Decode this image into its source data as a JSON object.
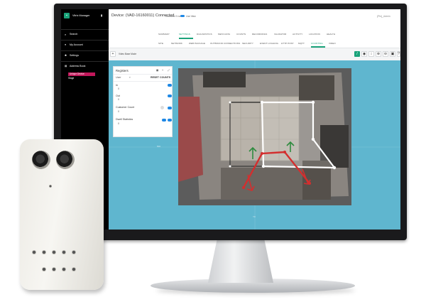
{
  "app": {
    "title": "Vitrix Manager",
    "brand_color": "#1aa37a",
    "accent_color": "#1e88e5",
    "highlight_color": "#c2185b"
  },
  "sidebar": {
    "search": "Search",
    "items": [
      "My Account",
      "Settings",
      "Address Book"
    ],
    "sub_items": [
      "Unique Device",
      "Stage"
    ]
  },
  "header": {
    "device_title": "Device: (VAD-16160011) Connected",
    "status_label": "Database Error",
    "live_view": "Live View",
    "user": "{Pin}_Admin"
  },
  "tabs_primary": [
    "SUMMARY",
    "SETTINGS",
    "DIAGNOSTICS",
    "META DATA",
    "COUNTS",
    "RECORDINGS",
    "VALIDATOR",
    "ACTIVITY",
    "LOCATION",
    "HEALTH"
  ],
  "tabs_primary_active": "SETTINGS",
  "tabs_secondary": [
    "SITE",
    "NETWORK",
    "WEB PACKAGE",
    "OUTBOUND CONNECTIONS",
    "SECURITY",
    "EVENT LOGGING",
    "HTTP POST",
    "MQTT",
    "COUNTING",
    "VIDEO"
  ],
  "tabs_secondary_active": "COUNTING",
  "toolbar": {
    "mode_label": "Video Base Mode"
  },
  "registers": {
    "title": "Registers",
    "filter_value": "User",
    "reset_label": "RESET COUNTS",
    "items": [
      {
        "name": "In",
        "count": "0"
      },
      {
        "name": "Out",
        "count": "0"
      },
      {
        "name": "Customer Count",
        "count": "0"
      },
      {
        "name": "Dwell Statistics",
        "count": "0"
      }
    ]
  },
  "canvas": {
    "grid_label_left": "500",
    "grid_label_right": "500",
    "grid_label_bottom": "Y0"
  }
}
